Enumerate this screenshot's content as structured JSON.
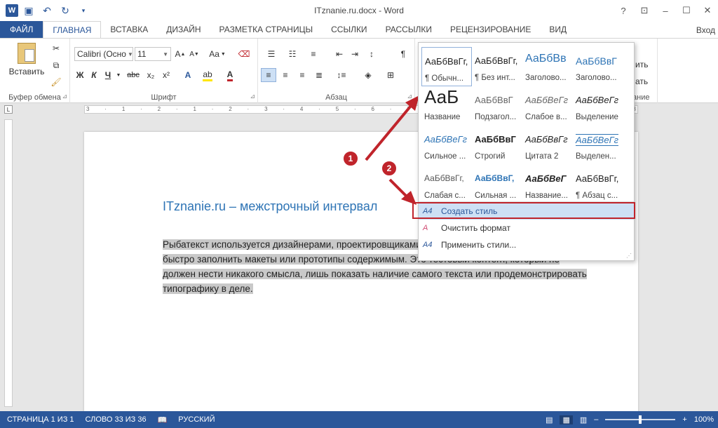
{
  "window": {
    "title": "ITznanie.ru.docx - Word",
    "controls": [
      "?",
      "⊡",
      "–",
      "☐",
      "✕"
    ]
  },
  "tabs": [
    {
      "label": "ФАЙЛ"
    },
    {
      "label": "ГЛАВНАЯ"
    },
    {
      "label": "ВСТАВКА"
    },
    {
      "label": "ДИЗАЙН"
    },
    {
      "label": "РАЗМЕТКА СТРАНИЦЫ"
    },
    {
      "label": "ССЫЛКИ"
    },
    {
      "label": "РАССЫЛКИ"
    },
    {
      "label": "РЕЦЕНЗИРОВАНИЕ"
    },
    {
      "label": "ВИД"
    }
  ],
  "signin": "Вход",
  "clipboard": {
    "paste": "Вставить",
    "label": "Буфер обмена"
  },
  "font": {
    "name": "Calibri (Осно",
    "size": "11",
    "label": "Шрифт",
    "case": "Aa",
    "bold": "Ж",
    "italic": "К",
    "underline": "Ч",
    "strike": "abc",
    "sub": "x₂",
    "sup": "x²"
  },
  "paragraph": {
    "label": "Абзац"
  },
  "styles_partial": {
    "line1": "ить",
    "line2": "ать",
    "label": "ание"
  },
  "gallery": {
    "styles": [
      {
        "preview": "АаБбВвГг,",
        "name": "¶ Обычн..."
      },
      {
        "preview": "АаБбВвГг,",
        "name": "¶ Без инт..."
      },
      {
        "preview": "АаБбВв",
        "name": "Заголово..."
      },
      {
        "preview": "АаБбВвГ",
        "name": "Заголово..."
      },
      {
        "preview": "АаБ",
        "name": "Название"
      },
      {
        "preview": "АаБбВвГ",
        "name": "Подзагол..."
      },
      {
        "preview": "АаБбВеГг",
        "name": "Слабое в..."
      },
      {
        "preview": "АаБбВеГг",
        "name": "Выделение"
      },
      {
        "preview": "АаБбВеГг",
        "name": "Сильное ..."
      },
      {
        "preview": "АаБбВвГ",
        "name": "Строгий"
      },
      {
        "preview": "АаБбВвГг",
        "name": "Цитата 2"
      },
      {
        "preview": "АаБбВеГг",
        "name": "Выделен..."
      },
      {
        "preview": "АаБбВвГг,",
        "name": "Слабая с..."
      },
      {
        "preview": "АаБбВвГ,",
        "name": "Сильная ..."
      },
      {
        "preview": "АаБбВеГ",
        "name": "Название..."
      },
      {
        "preview": "АаБбВвГг,",
        "name": "¶ Абзац с..."
      }
    ],
    "menu": [
      {
        "icon": "A4",
        "label": "Создать стиль"
      },
      {
        "icon": "A",
        "label": "Очистить формат"
      },
      {
        "icon": "A4",
        "label": "Применить стили..."
      }
    ]
  },
  "callouts": [
    "1",
    "2"
  ],
  "ruler": {
    "ticks": [
      "3",
      "·",
      "1",
      "·",
      "2",
      "·",
      "1",
      "·",
      "2",
      "·",
      "3",
      "·",
      "4",
      "·",
      "5",
      "·",
      "6",
      "·",
      "7",
      "·",
      "8",
      "·",
      "9",
      "·",
      "10",
      "·",
      "11",
      "·",
      "12",
      "·",
      "13"
    ]
  },
  "document": {
    "heading": "ITznanie.ru – межстрочный интервал",
    "body": "Рыбатекст используется дизайнерами, проектировщиками и фронтендерами, когда нужно быстро заполнить макеты или прототипы содержимым. Это тестовый контент, который не должен нести никакого смысла, лишь показать наличие самого текста или продемонстрировать типографику в деле."
  },
  "status": {
    "page": "СТРАНИЦА 1 ИЗ 1",
    "words": "СЛОВО 33 ИЗ 36",
    "lang": "РУССКИЙ",
    "zoom": "100%",
    "zoom_minus": "–",
    "zoom_plus": "+"
  },
  "colors": {
    "accent": "#2b579a",
    "highlight": "#c0242b",
    "heading": "#2e74b5"
  }
}
